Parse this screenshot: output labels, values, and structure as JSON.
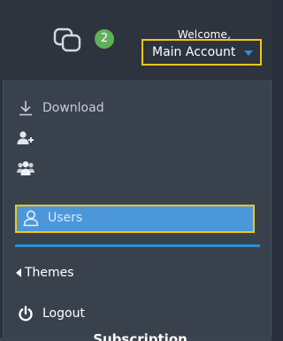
{
  "header": {
    "chat_badge_count": "2",
    "welcome_text": "Welcome,",
    "account_label": "Main Account"
  },
  "menu": {
    "download_label": "Download",
    "users_label": "Users",
    "themes_label": "Themes",
    "logout_label": "Logout"
  },
  "footer": {
    "subscription_label": "Subscription"
  },
  "colors": {
    "highlight_border": "#f5c518",
    "selected_bg": "#4c97d9",
    "accent_blue": "#2d8fd6",
    "badge_green": "#5eb159"
  },
  "icons": {
    "chat": "chat-bubbles-icon",
    "download": "download-icon",
    "add_user": "add-user-icon",
    "groups": "user-group-icon",
    "user": "user-icon",
    "themes": "caret-left-icon",
    "logout": "power-icon",
    "dropdown": "caret-down-icon"
  }
}
